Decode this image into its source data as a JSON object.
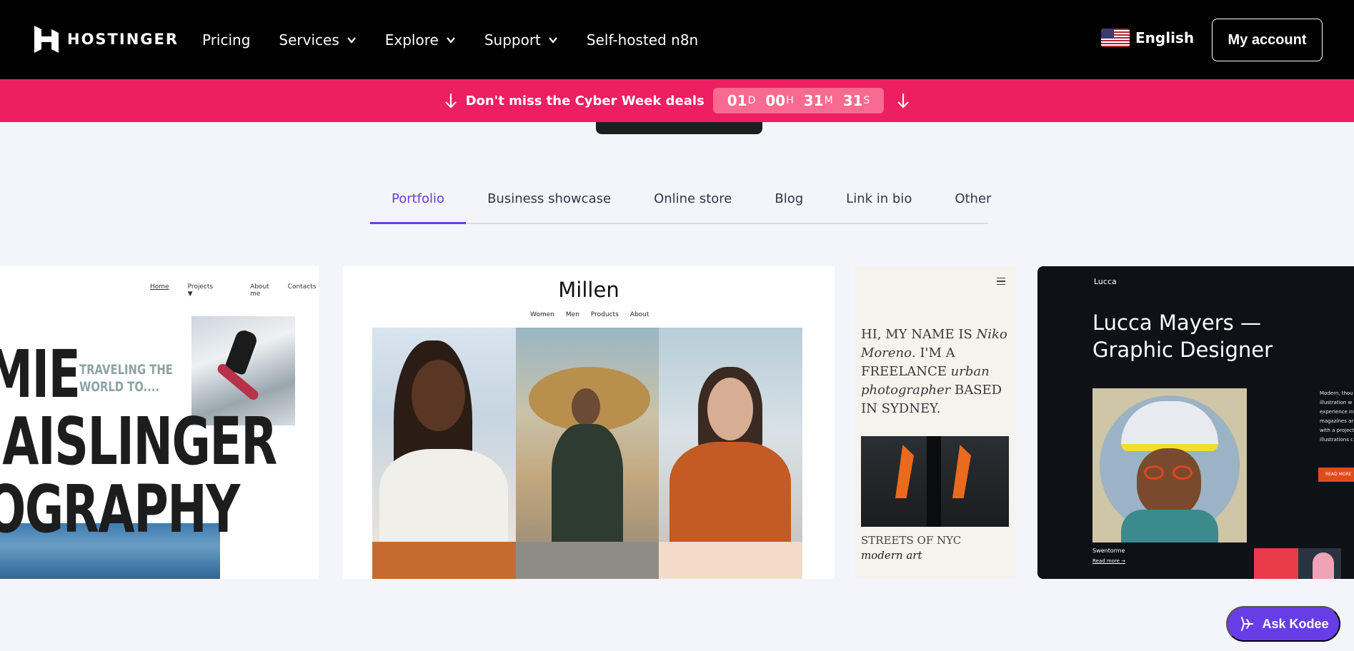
{
  "header": {
    "logo_text": "HOSTINGER",
    "nav": [
      {
        "label": "Pricing",
        "has_dropdown": false
      },
      {
        "label": "Services",
        "has_dropdown": true
      },
      {
        "label": "Explore",
        "has_dropdown": true
      },
      {
        "label": "Support",
        "has_dropdown": true
      },
      {
        "label": "Self-hosted n8n",
        "has_dropdown": false
      }
    ],
    "language": "English",
    "account_button": "My account"
  },
  "promo": {
    "text": "Don't miss the Cyber Week deals",
    "countdown": {
      "days": "01",
      "days_unit": "D",
      "hours": "00",
      "hours_unit": "H",
      "minutes": "31",
      "minutes_unit": "M",
      "seconds": "31",
      "seconds_unit": "S"
    },
    "color": "#ee1e63"
  },
  "tabs": [
    {
      "label": "Portfolio",
      "active": true
    },
    {
      "label": "Business showcase",
      "active": false
    },
    {
      "label": "Online store",
      "active": false
    },
    {
      "label": "Blog",
      "active": false
    },
    {
      "label": "Link in bio",
      "active": false
    },
    {
      "label": "Other",
      "active": false
    }
  ],
  "templates": {
    "card1": {
      "nav": [
        "Home",
        "Projects",
        "About me",
        "Contacts"
      ],
      "projects_caret": "▼",
      "big_lines": [
        "MIE",
        "IAISLINGER",
        "OGRAPHY"
      ],
      "subtitle": "TRAVELING THE\nWORLD TO...."
    },
    "card2": {
      "title": "Millen",
      "nav": [
        "Women",
        "Men",
        "Products",
        "About"
      ]
    },
    "card3": {
      "intro_1": "HI, MY NAME IS ",
      "intro_name": "Niko Moreno",
      "intro_2": ". I'M A FREELANCE ",
      "intro_role": "urban photographer",
      "intro_3": " BASED IN SYDNEY.",
      "caption": "STREETS OF NYC",
      "caption_italic": "modern art"
    },
    "card4": {
      "brand": "Lucca",
      "title": "Lucca Mayers — Graphic Designer",
      "caption": "Swentorme",
      "read_more": "Read more →",
      "side_text": "Modern, thou illustration w experience in magazines ar with a project illustrations c",
      "side_button": "READ MORE"
    }
  },
  "kodee": {
    "label": "Ask Kodee"
  },
  "colors": {
    "accent": "#673de6",
    "header_bg": "#000000",
    "page_bg": "#f4f5fb"
  }
}
